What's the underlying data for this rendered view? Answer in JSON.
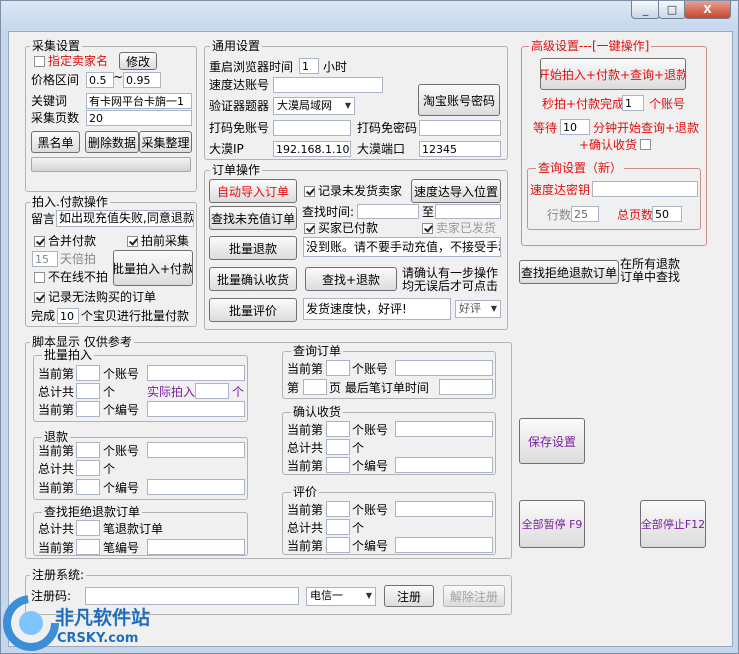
{
  "window": {
    "min": "_",
    "max": "□",
    "close": "X"
  },
  "collect": {
    "title": "采集设置",
    "chk_seller": "指定卖家名",
    "modify": "修改",
    "price_lbl": "价格区间",
    "price_min": "0.5",
    "tilde": "~",
    "price_max": "0.95",
    "kw_lbl": "关键词",
    "kw_val": "有卡网平台卡旓一1",
    "pages_lbl": "采集页数",
    "pages_val": "20",
    "btn_black": "黑名单",
    "btn_del": "删除数据",
    "btn_sort": "采集整理"
  },
  "pay": {
    "title": "拍入.付款操作",
    "leave": "留言",
    "leave_val": "如出现充值失败,同意退款",
    "chk_merge": "合并付款",
    "chk_precollect": "拍前采集",
    "times_val": "15",
    "times_lbl": "天倍拍",
    "chk_offline": "不在线不拍",
    "btn_batch": "批量拍入+付款",
    "chk_record": "记录无法购买的订单",
    "done_pre": "完成",
    "done_val": "10",
    "done_post": "个宝贝进行批量付款"
  },
  "general": {
    "title": "通用设置",
    "restart": "重启浏览器时间",
    "restart_val": "1",
    "hour": "小时",
    "speed_acc": "速度达账号",
    "verifier": "验证器题器",
    "verifier_val": "大漠局域网",
    "taobao_btn": "淘宝账号密码",
    "captcha_acc": "打码免账号",
    "captcha_pwd": "打码免密码",
    "dm_ip_lbl": "大漠IP",
    "dm_ip": "192.168.1.101",
    "dm_port_lbl": "大漠端口",
    "dm_port": "12345"
  },
  "order": {
    "title": "订单操作",
    "btn_auto": "自动导入订单",
    "chk_unshipped": "记录未发货卖家",
    "btn_speed_import": "速度达导入位置",
    "btn_find_unrecharged": "查找未充值订单",
    "query_time": "查找时间:",
    "to": "至",
    "chk_paid": "买家已付款",
    "chk_shipped": "卖家已发货",
    "btn_refund": "批量退款",
    "refund_msg": "没到账。请不要手动充值，不接受手动",
    "btn_confirm": "批量确认收货",
    "btn_find_refund": "查找+退款",
    "note1": "请确认有一步操作",
    "note2": "均无误后才可点击",
    "btn_review": "批量评价",
    "review_msg": "发货速度快，好评!",
    "review_sel": "好评",
    "btn_find_reject": "查找拒绝退款订单",
    "note3": "在所有退款",
    "note4": "订单中查找"
  },
  "advanced": {
    "title": "高级设置---[一键操作]",
    "btn_onekey": "开始拍入+付款+查询+退款",
    "sec_done": "秒拍+付款完成",
    "sec_val": "1",
    "sec_unit": "个账号",
    "wait": "等待",
    "wait_val": "10",
    "wait_text": "分钟开始查询+退款",
    "confirm": "+确认收货",
    "query_title": "查询设置（新）",
    "speed_key": "速度达密钥",
    "rows": "行数",
    "rows_val": "25",
    "pages": "总页数",
    "pages_val": "50"
  },
  "script": {
    "title": "脚本显示  仅供参考",
    "batch_title": "批量拍入",
    "cur": "当前第",
    "acc_unit": "个账号",
    "total": "总计共",
    "unit": "个",
    "actual": "实际拍入",
    "item_unit": "个编号",
    "refund_title": "退款",
    "reject_title": "查找拒绝退款订单",
    "reject_unit": "笔退款订单",
    "order_no": "笔编号",
    "query_title": "查询订单",
    "page_pre": "第",
    "page_post": "页  最后笔订单时间",
    "confirm_title": "确认收货",
    "review_title": "评价"
  },
  "right": {
    "save": "保存设置",
    "pause": "全部暂停 F9",
    "stop": "全部停止F12"
  },
  "reg": {
    "title": "注册系统:",
    "code_lbl": "注册码:",
    "isp": "电信一",
    "btn_reg": "注册",
    "btn_unreg": "解除注册"
  },
  "watermark": {
    "cn": "非凡软件站",
    "en": "CRSKY.com"
  },
  "colors": {
    "accent_red": "#e01010",
    "purple": "#7b1fa2"
  }
}
